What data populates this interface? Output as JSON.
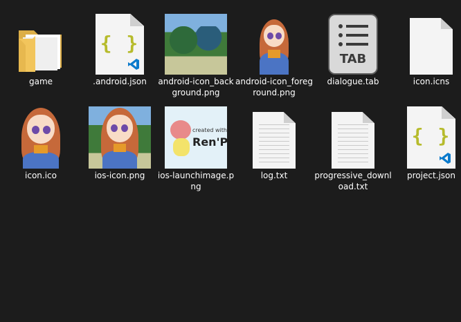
{
  "files": [
    {
      "name": "game",
      "icon": "folder-icon"
    },
    {
      "name": ".android.json",
      "icon": "json-vscode-icon"
    },
    {
      "name": "android-icon_background.png",
      "icon": "image-thumbnail-park"
    },
    {
      "name": "android-icon_foreground.png",
      "icon": "image-thumbnail-character"
    },
    {
      "name": "dialogue.tab",
      "icon": "tab-file-icon",
      "badge": "TAB"
    },
    {
      "name": "icon.icns",
      "icon": "blank-file-icon"
    },
    {
      "name": "icon.ico",
      "icon": "image-thumbnail-character"
    },
    {
      "name": "ios-icon.png",
      "icon": "image-thumbnail-character-park"
    },
    {
      "name": "ios-launchimage.png",
      "icon": "image-thumbnail-renpy",
      "badge_line1": "created with",
      "badge_line2": "Ren'Py"
    },
    {
      "name": "log.txt",
      "icon": "text-file-icon"
    },
    {
      "name": "progressive_download.txt",
      "icon": "text-file-icon"
    },
    {
      "name": "project.json",
      "icon": "json-vscode-icon"
    }
  ],
  "json_glyph": "{ }",
  "colors": {
    "background": "#1c1c1c",
    "folder": "#f2c55c",
    "braces": "#b6bb2c",
    "vscode": "#0a7acc"
  }
}
